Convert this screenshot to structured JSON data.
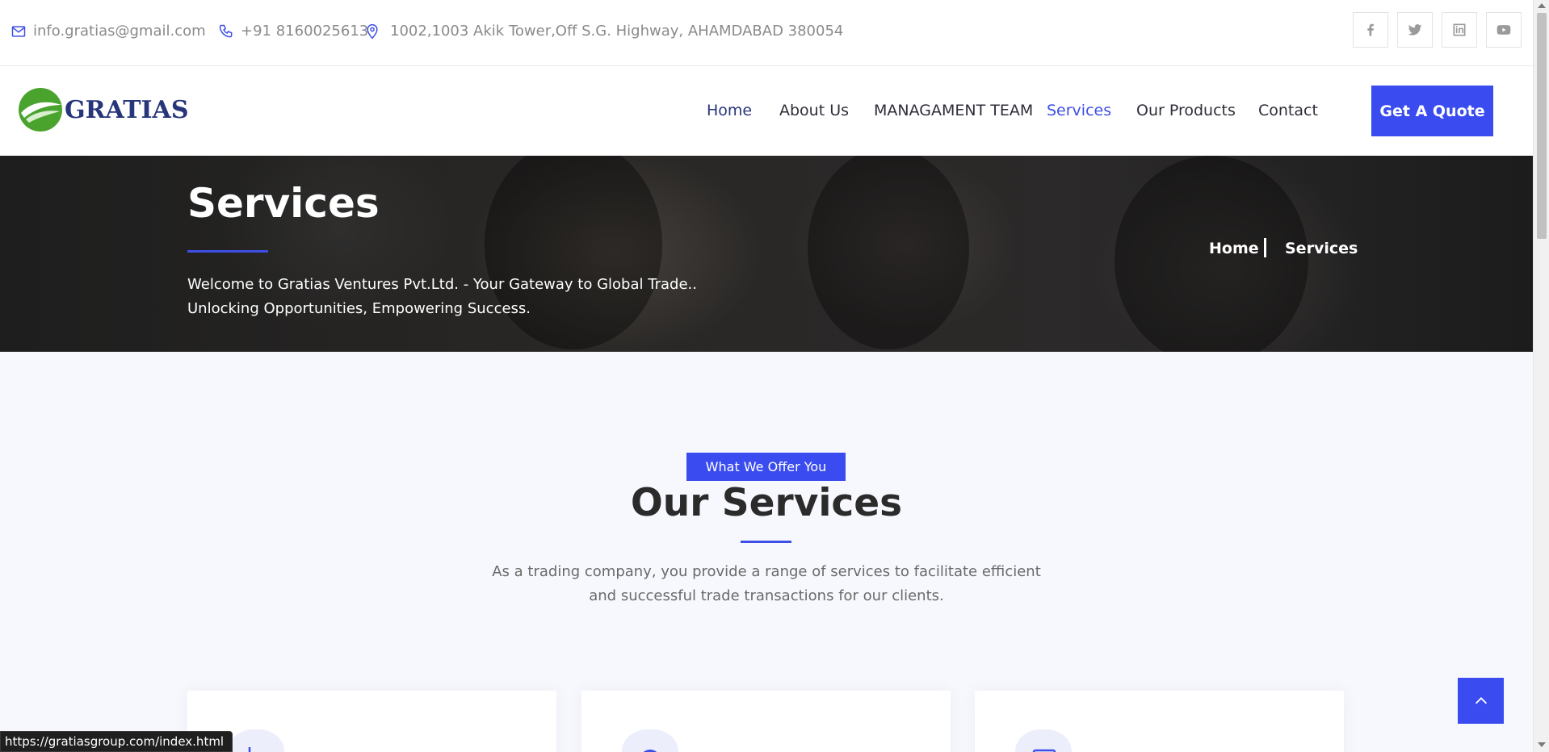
{
  "topbar": {
    "email": "info.gratias@gmail.com",
    "phone": "+91 8160025613",
    "address": "1002,1003 Akik Tower,Off S.G. Highway, AHAMDABAD 380054"
  },
  "header": {
    "logo_text": "GRATIAS",
    "nav": {
      "home": "Home",
      "about": "About Us",
      "team": "MANAGAMENT TEAM",
      "services": "Services",
      "products": "Our Products",
      "contact": "Contact"
    },
    "quote_button": "Get A Quote"
  },
  "hero": {
    "title": "Services",
    "subtitle_line1": "Welcome to Gratias Ventures Pvt.Ltd. - Your Gateway to Global Trade..",
    "subtitle_line2": "Unlocking Opportunities, Empowering Success.",
    "breadcrumb_home": "Home",
    "breadcrumb_current": "Services"
  },
  "services": {
    "tagline": "What We Offer You",
    "title": "Our Services",
    "desc_line1": "As a trading company, you provide a range of services to facilitate efficient",
    "desc_line2": "and successful trade transactions for our clients."
  },
  "statusbar": {
    "url": "https://gratiasgroup.com/index.html"
  },
  "colors": {
    "accent": "#3a4cf0",
    "logo_blue": "#27357a",
    "logo_green": "#4aa32d",
    "background": "#f7f8fd"
  },
  "icons": {
    "social": [
      "facebook-icon",
      "twitter-icon",
      "linkedin-icon",
      "youtube-icon"
    ],
    "back_to_top": "chevron-up-icon"
  }
}
